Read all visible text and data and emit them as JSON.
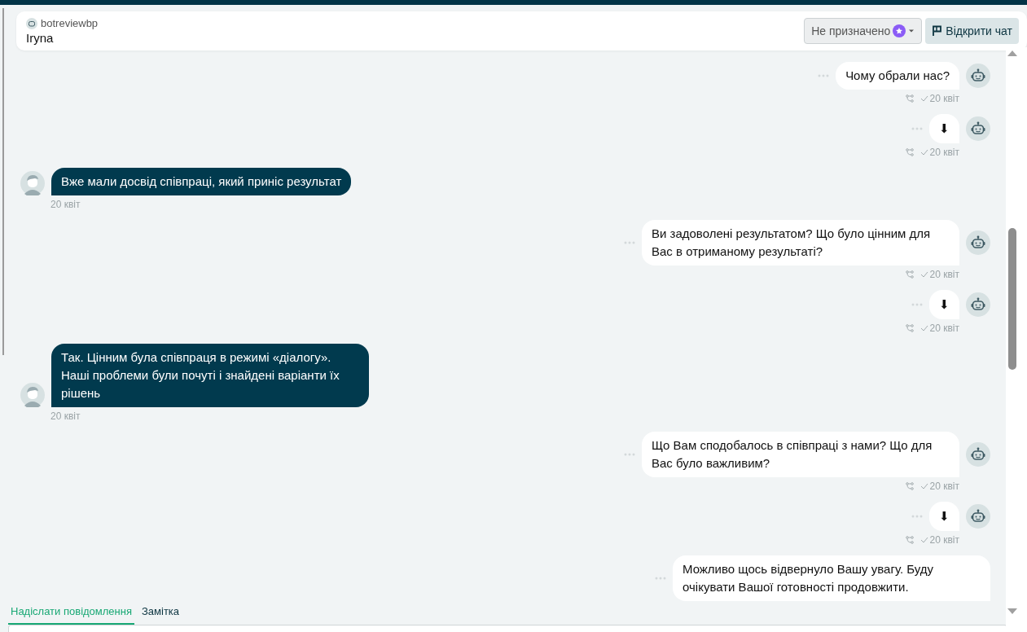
{
  "header": {
    "channel": "botreviewbp",
    "contact": "Iryna",
    "assignee": "Не призначено",
    "open_button": "Відкрити чат"
  },
  "messages": [
    {
      "kind": "bot",
      "text": "Чому обрали нас?",
      "time": "20 квіт"
    },
    {
      "kind": "bot",
      "text": "⬇",
      "time": "20 квіт"
    },
    {
      "kind": "user",
      "text": "Вже мали досвід співпраці, який приніс результат",
      "time": "20 квіт"
    },
    {
      "kind": "bot",
      "text": "Ви задоволені результатом? Що було цінним для Вас в отриманому результаті?",
      "time": "20 квіт"
    },
    {
      "kind": "bot",
      "text": "⬇",
      "time": "20 квіт"
    },
    {
      "kind": "user",
      "text": "Так. Цінним була співпраця в режимі «діалогу». Наші проблеми були почуті і знайдені варіанти їх рішень",
      "time": "20 квіт"
    },
    {
      "kind": "bot",
      "text": "Що Вам сподобалось в співпраці з нами? Що для Вас було важливим?",
      "time": "20 квіт"
    },
    {
      "kind": "bot",
      "text": "⬇",
      "time": "20 квіт"
    },
    {
      "kind": "bot",
      "text": "Можливо щось відвернуло Вашу увагу. Буду очікувати Вашої готовності продовжити."
    }
  ],
  "composer": {
    "tabs": [
      {
        "label": "Надіслати повідомлення",
        "selected": true
      },
      {
        "label": "Замітка",
        "selected": false
      }
    ]
  }
}
